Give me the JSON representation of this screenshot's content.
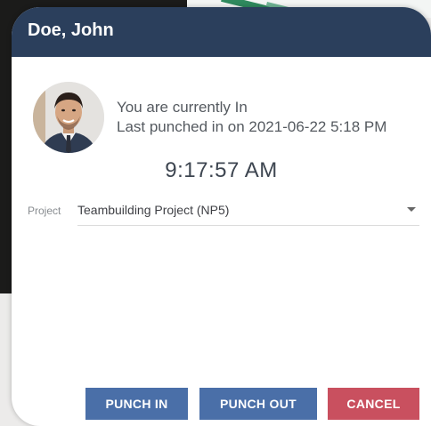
{
  "modal": {
    "title": "Doe, John"
  },
  "status": {
    "line1": "You are currently In",
    "line2": "Last punched in on 2021-06-22 5:18 PM"
  },
  "clock": {
    "time": "9:17:57 AM"
  },
  "project": {
    "label": "Project",
    "selected": "Teambuilding Project (NP5)"
  },
  "buttons": {
    "punch_in": "PUNCH IN",
    "punch_out": "PUNCH OUT",
    "cancel": "CANCEL"
  },
  "colors": {
    "header": "#2b3f5c",
    "primary_button": "#4a6fa8",
    "cancel_button": "#c9505f"
  }
}
